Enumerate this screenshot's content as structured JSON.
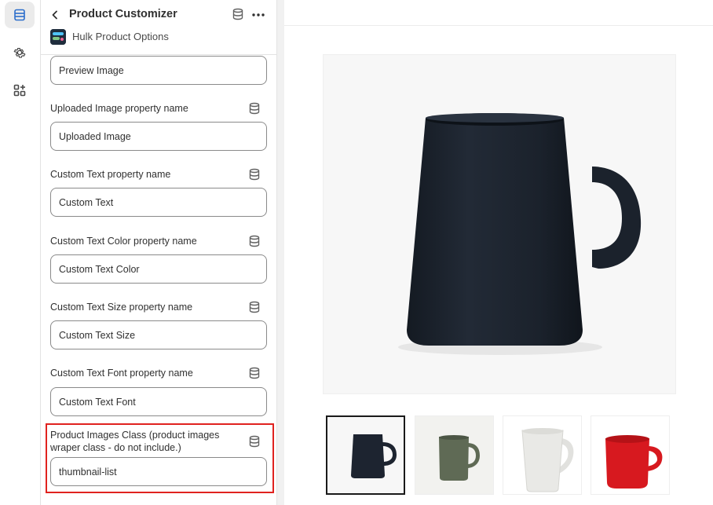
{
  "rail": {
    "items": [
      {
        "icon": "sections-icon",
        "active": true
      },
      {
        "icon": "gear-icon",
        "active": false
      },
      {
        "icon": "apps-icon",
        "active": false
      }
    ]
  },
  "panel": {
    "title": "Product Customizer",
    "app_name": "Hulk Product Options",
    "fields": [
      {
        "label": "",
        "value": "Preview Image"
      },
      {
        "label": "Uploaded Image property name",
        "value": "Uploaded Image"
      },
      {
        "label": "Custom Text property name",
        "value": "Custom Text"
      },
      {
        "label": "Custom Text Color property name",
        "value": "Custom Text Color"
      },
      {
        "label": "Custom Text Size property name",
        "value": "Custom Text Size"
      },
      {
        "label": "Custom Text Font property name",
        "value": "Custom Text Font"
      },
      {
        "label": "Product Images Class (product images wraper class - do not include.)",
        "value": "thumbnail-list"
      }
    ]
  },
  "preview": {
    "thumbnails": [
      {
        "color": "#1d2430",
        "selected": true
      },
      {
        "color": "#5f6a55",
        "selected": false
      },
      {
        "color": "#e9e9e6",
        "selected": false
      },
      {
        "color": "#d7191f",
        "selected": false
      }
    ]
  },
  "colors": {
    "highlight": "#e0221f",
    "mug_main": "#1b222c"
  }
}
